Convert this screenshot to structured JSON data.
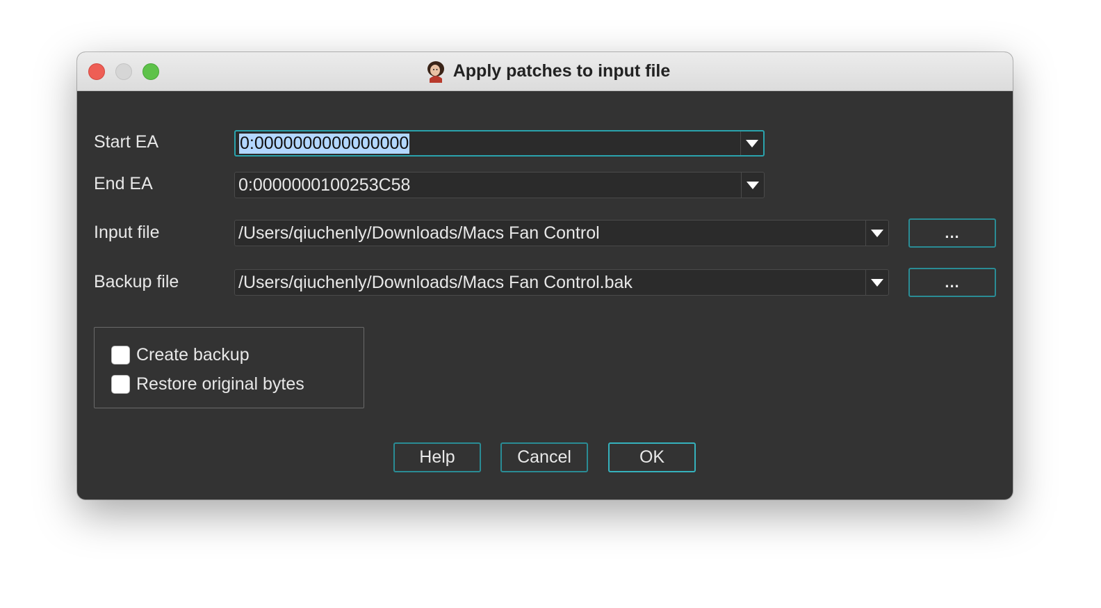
{
  "window": {
    "title": "Apply patches to input file",
    "app_icon": "ida-pro-icon"
  },
  "fields": {
    "start_ea": {
      "label": "Start EA",
      "value": "0:0000000000000000"
    },
    "end_ea": {
      "label": "End EA",
      "value": "0:0000000100253C58"
    },
    "input_file": {
      "label": "Input file",
      "value": "/Users/qiuchenly/Downloads/Macs Fan Control",
      "browse_label": "..."
    },
    "backup_file": {
      "label": "Backup file",
      "value": "/Users/qiuchenly/Downloads/Macs Fan Control.bak",
      "browse_label": "..."
    }
  },
  "options": {
    "create_backup": {
      "label": "Create backup",
      "checked": false
    },
    "restore_original": {
      "label": "Restore original bytes",
      "checked": false
    }
  },
  "buttons": {
    "help": "Help",
    "cancel": "Cancel",
    "ok": "OK"
  },
  "colors": {
    "dialog_bg": "#333333",
    "accent_border": "#2aa3ad",
    "selection": "#b3d7ff"
  }
}
